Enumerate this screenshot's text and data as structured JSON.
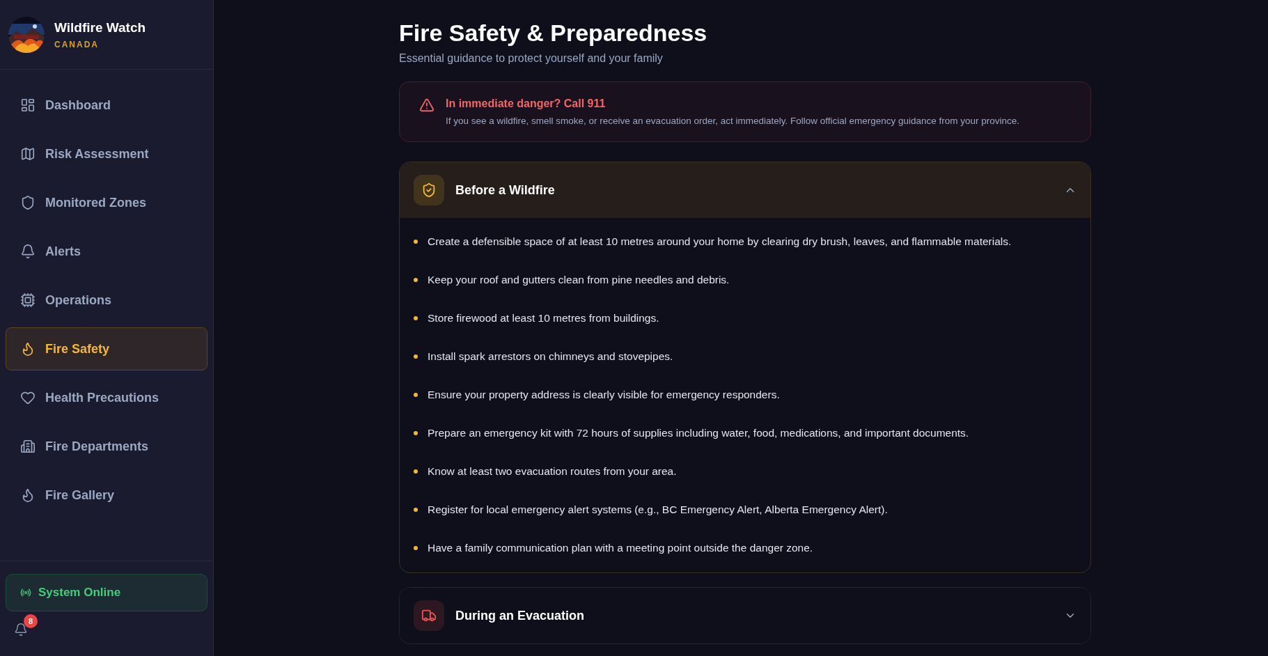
{
  "brand": {
    "title": "Wildfire Watch",
    "subtitle": "CANADA"
  },
  "sidebar": {
    "items": [
      {
        "label": "Dashboard",
        "selected": false
      },
      {
        "label": "Risk Assessment",
        "selected": false
      },
      {
        "label": "Monitored Zones",
        "selected": false
      },
      {
        "label": "Alerts",
        "selected": false
      },
      {
        "label": "Operations",
        "selected": false
      },
      {
        "label": "Fire Safety",
        "selected": true
      },
      {
        "label": "Health Precautions",
        "selected": false
      },
      {
        "label": "Fire Departments",
        "selected": false
      },
      {
        "label": "Fire Gallery",
        "selected": false
      }
    ]
  },
  "status": {
    "label": "System Online"
  },
  "notifications": {
    "count": "8"
  },
  "page": {
    "title": "Fire Safety & Preparedness",
    "subtitle": "Essential guidance to protect yourself and your family"
  },
  "alert": {
    "title": "In immediate danger? Call 911",
    "text": "If you see a wildfire, smell smoke, or receive an evacuation order, act immediately. Follow official emergency guidance from your province."
  },
  "sections": [
    {
      "title": "Before a Wildfire",
      "color": "#f5b82e",
      "expanded": true,
      "items": [
        "Create a defensible space of at least 10 metres around your home by clearing dry brush, leaves, and flammable materials.",
        "Keep your roof and gutters clean from pine needles and debris.",
        "Store firewood at least 10 metres from buildings.",
        "Install spark arrestors on chimneys and stovepipes.",
        "Ensure your property address is clearly visible for emergency responders.",
        "Prepare an emergency kit with 72 hours of supplies including water, food, medications, and important documents.",
        "Know at least two evacuation routes from your area.",
        "Register for local emergency alert systems (e.g., BC Emergency Alert, Alberta Emergency Alert).",
        "Have a family communication plan with a meeting point outside the danger zone."
      ]
    },
    {
      "title": "During an Evacuation",
      "color": "#f05252",
      "expanded": false
    }
  ]
}
